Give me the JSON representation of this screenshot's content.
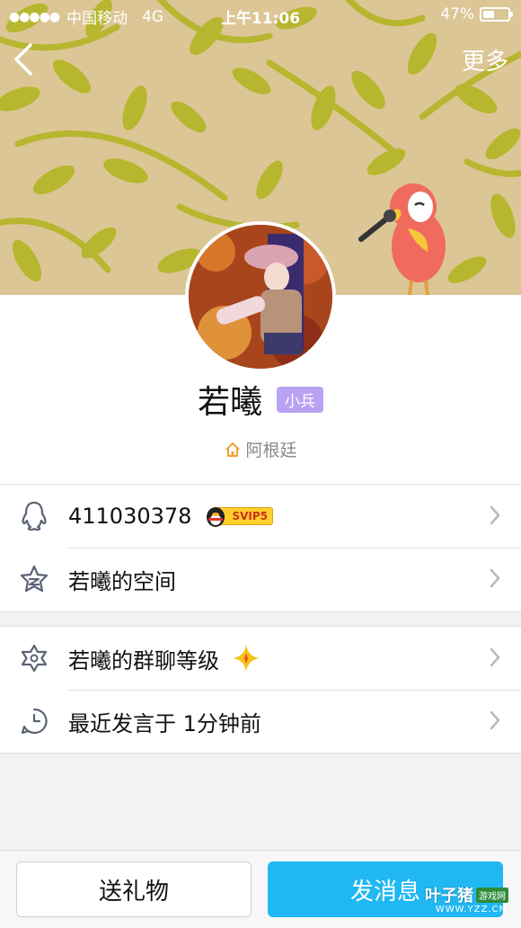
{
  "status_bar": {
    "signal_dots": "●●●●●",
    "carrier": "中国移动",
    "network": "4G",
    "time": "上午11:06",
    "battery_text": "47%",
    "battery_level": 0.47
  },
  "header": {
    "back_icon": "chevron-left-icon",
    "more_label": "更多"
  },
  "profile": {
    "name": "若曦",
    "level_badge": "小兵",
    "location": "阿根廷"
  },
  "info_list": [
    {
      "icon": "qq-penguin-icon",
      "label": "411030378",
      "badge": "SVIP5"
    },
    {
      "icon": "star-space-icon",
      "label": "若曦的空间"
    }
  ],
  "group_list": [
    {
      "icon": "hexagram-icon",
      "label": "若曦的群聊等级",
      "badge_icon": "gold-sparkle-icon"
    },
    {
      "icon": "clock-icon",
      "label": "最近发言于 1分钟前"
    }
  ],
  "bottom_bar": {
    "gift_label": "送礼物",
    "message_label": "发消息"
  },
  "watermark": {
    "name": "叶子猪",
    "tag": "游戏网",
    "url": "WWW.YZZ.CN"
  },
  "colors": {
    "banner_bg": "#dcc696",
    "leaf": "#b7b62f",
    "badge": "#b9a2f4",
    "primary_button": "#20b8f2",
    "icon_gray": "#5a6274",
    "parrot": "#f06a5e"
  }
}
